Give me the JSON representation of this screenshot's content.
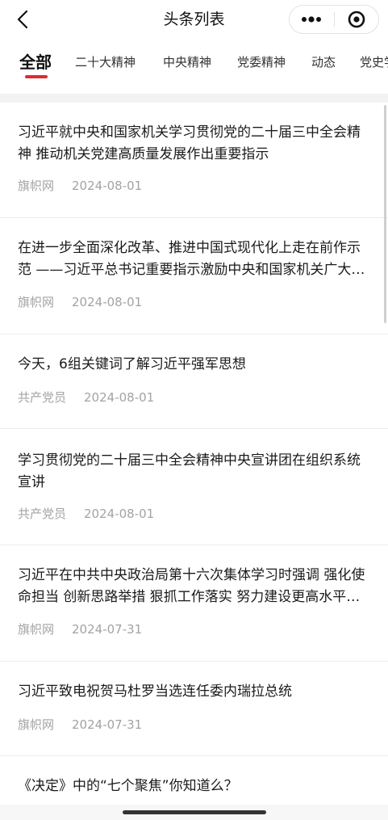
{
  "navbar": {
    "title": "头条列表"
  },
  "tabs": [
    {
      "label": "全部",
      "active": true
    },
    {
      "label": "二十大精神",
      "active": false
    },
    {
      "label": "中央精神",
      "active": false
    },
    {
      "label": "党委精神",
      "active": false
    },
    {
      "label": "动态",
      "active": false
    },
    {
      "label": "党史学习",
      "active": false
    }
  ],
  "colors": {
    "accent": "#e02b2b",
    "meta": "#a3a3a3",
    "band": "#f2f2f2"
  },
  "articles": [
    {
      "title": "习近平就中央和国家机关学习贯彻党的二十届三中全会精神 推动机关党建高质量发展作出重要指示",
      "source": "旗帜网",
      "date": "2024-08-01"
    },
    {
      "title": "在进一步全面深化改革、推进中国式现代化上走在前作示范 ——习近平总书记重要指示激励中央和国家机关广大党员干部",
      "source": "旗帜网",
      "date": "2024-08-01"
    },
    {
      "title": "今天，6组关键词了解习近平强军思想",
      "source": "共产党员",
      "date": "2024-08-01"
    },
    {
      "title": "学习贯彻党的二十届三中全会精神中央宣讲团在组织系统宣讲",
      "source": "共产党员",
      "date": "2024-08-01"
    },
    {
      "title": "习近平在中共中央政治局第十六次集体学习时强调 强化使命担当 创新思路举措 狠抓工作落实 努力建设更高水平的平安中国",
      "source": "旗帜网",
      "date": "2024-07-31"
    },
    {
      "title": "习近平致电祝贺马杜罗当选连任委内瑞拉总统",
      "source": "旗帜网",
      "date": "2024-07-31"
    },
    {
      "title": "《决定》中的“七个聚焦”你知道么？",
      "source": "",
      "date": ""
    }
  ]
}
